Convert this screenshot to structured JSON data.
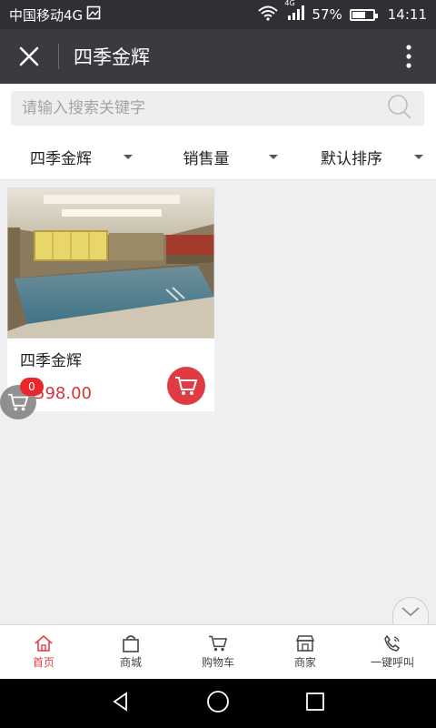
{
  "status_bar": {
    "carrier": "中国移动4G",
    "network_tag": "4G",
    "battery": "57%",
    "time": "14:11"
  },
  "title_bar": {
    "title": "四季金辉"
  },
  "search": {
    "placeholder": "请输入搜索关键字"
  },
  "filters": [
    {
      "label": "四季金辉"
    },
    {
      "label": "销售量"
    },
    {
      "label": "默认排序"
    }
  ],
  "products": [
    {
      "name": "四季金辉",
      "price": "598.00"
    }
  ],
  "floating_cart": {
    "count": "0"
  },
  "bottom_nav": [
    {
      "label": "首页",
      "icon": "home-icon",
      "active": true
    },
    {
      "label": "商城",
      "icon": "bag-icon"
    },
    {
      "label": "购物车",
      "icon": "cart-icon"
    },
    {
      "label": "商家",
      "icon": "store-icon"
    },
    {
      "label": "一键呼叫",
      "icon": "phone-icon"
    }
  ],
  "colors": {
    "accent": "#e3414b",
    "title_bar": "#3a3b3f",
    "status_bar": "#2f3035"
  }
}
